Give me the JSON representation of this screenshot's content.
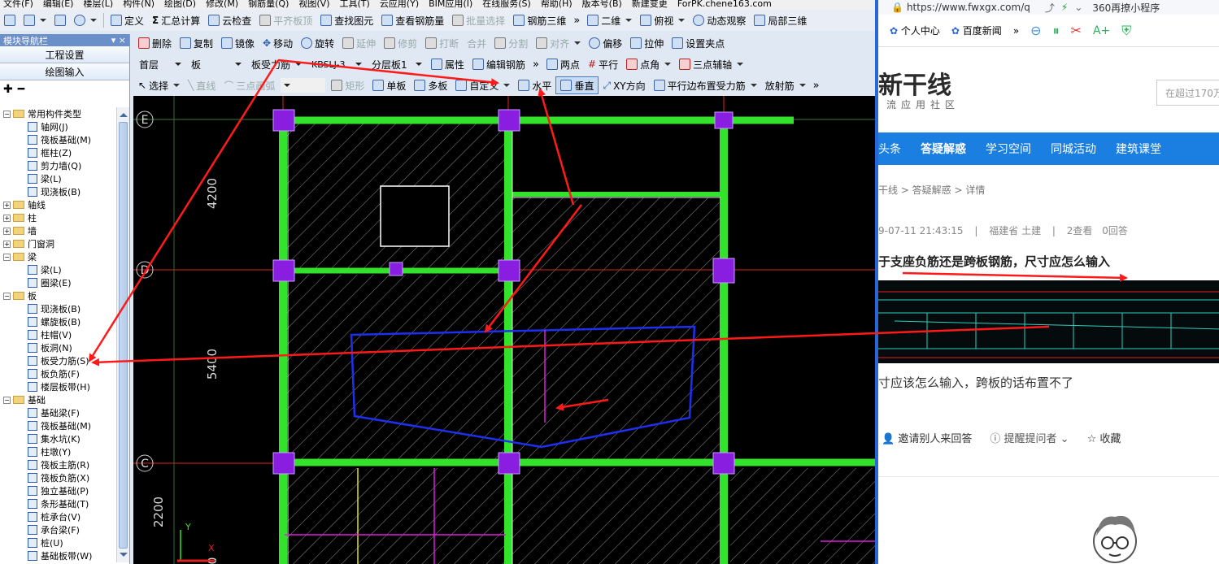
{
  "menubar": {
    "items": [
      "文件(F)",
      "编辑(E)",
      "楼层(L)",
      "构件(N)",
      "绘图(D)",
      "修改(M)",
      "钢筋量(Q)",
      "视图(V)",
      "工具(T)",
      "云应用(Y)",
      "BIM应用(I)",
      "在线服务(S)",
      "帮助(H)",
      "版本号(B)",
      "新建变更",
      "ForPK.chene163.com"
    ]
  },
  "toolbar1": {
    "define": "定义",
    "sum_calc": "汇总计算",
    "cloud_check": "云检查",
    "flat_top": "平齐板顶",
    "find_elem": "查找图元",
    "view_rebar": "查看钢筋量",
    "batch_select": "批量选择",
    "rebar_3d": "钢筋三维",
    "view_2d": "二维",
    "top_view": "俯视",
    "dynamic_view": "动态观察",
    "local_3d": "局部三维"
  },
  "nav": {
    "title": "模块导航栏",
    "pin": "▾",
    "close": "×",
    "project_settings": "工程设置",
    "drawing_input": "绘图输入",
    "tree": [
      {
        "label": "常用构件类型",
        "level": 0,
        "type": "folder",
        "open": true
      },
      {
        "label": "轴网(J)",
        "level": 1,
        "type": "item"
      },
      {
        "label": "筏板基础(M)",
        "level": 1,
        "type": "item"
      },
      {
        "label": "框柱(Z)",
        "level": 1,
        "type": "item"
      },
      {
        "label": "剪力墙(Q)",
        "level": 1,
        "type": "item"
      },
      {
        "label": "梁(L)",
        "level": 1,
        "type": "item"
      },
      {
        "label": "现浇板(B)",
        "level": 1,
        "type": "item"
      },
      {
        "label": "轴线",
        "level": 0,
        "type": "folder",
        "open": false
      },
      {
        "label": "柱",
        "level": 0,
        "type": "folder",
        "open": false
      },
      {
        "label": "墙",
        "level": 0,
        "type": "folder",
        "open": false
      },
      {
        "label": "门窗洞",
        "level": 0,
        "type": "folder",
        "open": false
      },
      {
        "label": "梁",
        "level": 0,
        "type": "folder",
        "open": true
      },
      {
        "label": "梁(L)",
        "level": 1,
        "type": "item"
      },
      {
        "label": "圈梁(E)",
        "level": 1,
        "type": "item"
      },
      {
        "label": "板",
        "level": 0,
        "type": "folder",
        "open": true
      },
      {
        "label": "现浇板(B)",
        "level": 1,
        "type": "item"
      },
      {
        "label": "螺旋板(B)",
        "level": 1,
        "type": "item"
      },
      {
        "label": "柱帽(V)",
        "level": 1,
        "type": "item"
      },
      {
        "label": "板洞(N)",
        "level": 1,
        "type": "item"
      },
      {
        "label": "板受力筋(S)",
        "level": 1,
        "type": "item"
      },
      {
        "label": "板负筋(F)",
        "level": 1,
        "type": "item"
      },
      {
        "label": "楼层板带(H)",
        "level": 1,
        "type": "item"
      },
      {
        "label": "基础",
        "level": 0,
        "type": "folder",
        "open": true
      },
      {
        "label": "基础梁(F)",
        "level": 1,
        "type": "item"
      },
      {
        "label": "筏板基础(M)",
        "level": 1,
        "type": "item"
      },
      {
        "label": "集水坑(K)",
        "level": 1,
        "type": "item"
      },
      {
        "label": "柱墩(Y)",
        "level": 1,
        "type": "item"
      },
      {
        "label": "筏板主筋(R)",
        "level": 1,
        "type": "item"
      },
      {
        "label": "筏板负筋(X)",
        "level": 1,
        "type": "item"
      },
      {
        "label": "独立基础(P)",
        "level": 1,
        "type": "item"
      },
      {
        "label": "条形基础(T)",
        "level": 1,
        "type": "item"
      },
      {
        "label": "桩承台(V)",
        "level": 1,
        "type": "item"
      },
      {
        "label": "承台梁(F)",
        "level": 1,
        "type": "item"
      },
      {
        "label": "桩(U)",
        "level": 1,
        "type": "item"
      },
      {
        "label": "基础板带(W)",
        "level": 1,
        "type": "item"
      }
    ]
  },
  "toolbar2": {
    "delete": "删除",
    "copy": "复制",
    "mirror": "镜像",
    "move": "移动",
    "rotate": "旋转",
    "extend": "延伸",
    "trim": "修剪",
    "break": "打断",
    "merge": "合并",
    "split": "分割",
    "align": "对齐",
    "offset": "偏移",
    "stretch": "拉伸",
    "set_grip": "设置夹点"
  },
  "toolbar3": {
    "floor": "首层",
    "elem_type": "板",
    "sub_type": "板受力筋",
    "code": "KBSLJ-3",
    "layer": "分层板1",
    "props": "属性",
    "edit_rebar": "编辑钢筋",
    "two_points": "两点",
    "parallel": "平行",
    "point_angle": "点角",
    "three_point_aux": "三点辅轴"
  },
  "toolbar4": {
    "select": "选择",
    "line": "直线",
    "arc": "三点画弧",
    "rect": "矩形",
    "single_slab": "单板",
    "multi_slab": "多板",
    "custom": "自定义",
    "horizontal": "水平",
    "vertical": "垂直",
    "xy_dir": "XY方向",
    "parallel_edge": "平行边布置受力筋",
    "radial": "放射筋"
  },
  "canvas": {
    "axis_labels": [
      "E",
      "D",
      "C"
    ],
    "dims": [
      "4200",
      "5400",
      "2200"
    ],
    "dim_bottom": "0",
    "ucs_y": "Y",
    "ucs_x": "X"
  },
  "browser": {
    "url": "https://www.fwxgx.com/q",
    "address_right": "360再撩小程序",
    "bookmarks": {
      "personal": "个人中心",
      "baidu_news": "百度新闻",
      "more": "»"
    },
    "logo": "新干线",
    "slogan": "流应用社区",
    "search_placeholder": "在超过170万",
    "nav": [
      "头条",
      "答疑解惑",
      "学习空间",
      "同城活动",
      "建筑课堂"
    ],
    "active_nav": "答疑解惑",
    "breadcrumb": "干线 > 答疑解惑 > 详情",
    "meta": {
      "date": "9-07-11 21:43:15",
      "location": "福建省 土建",
      "views": "2查看",
      "answers": "0回答"
    },
    "question_title": "于支座负筋还是跨板钢筋，尺寸应怎么输入",
    "question_body": "寸应该怎么输入，跨板的话布置不了",
    "actions": {
      "invite": "邀请别人来回答",
      "remind": "提醒提问者",
      "favorite": "收藏"
    }
  },
  "colors": {
    "accent_nav": "#1a7fe0",
    "canvas_bg": "#000000",
    "beam": "#33e22a",
    "column": "#8a1ee0",
    "annotation": "#ff1a1a"
  }
}
